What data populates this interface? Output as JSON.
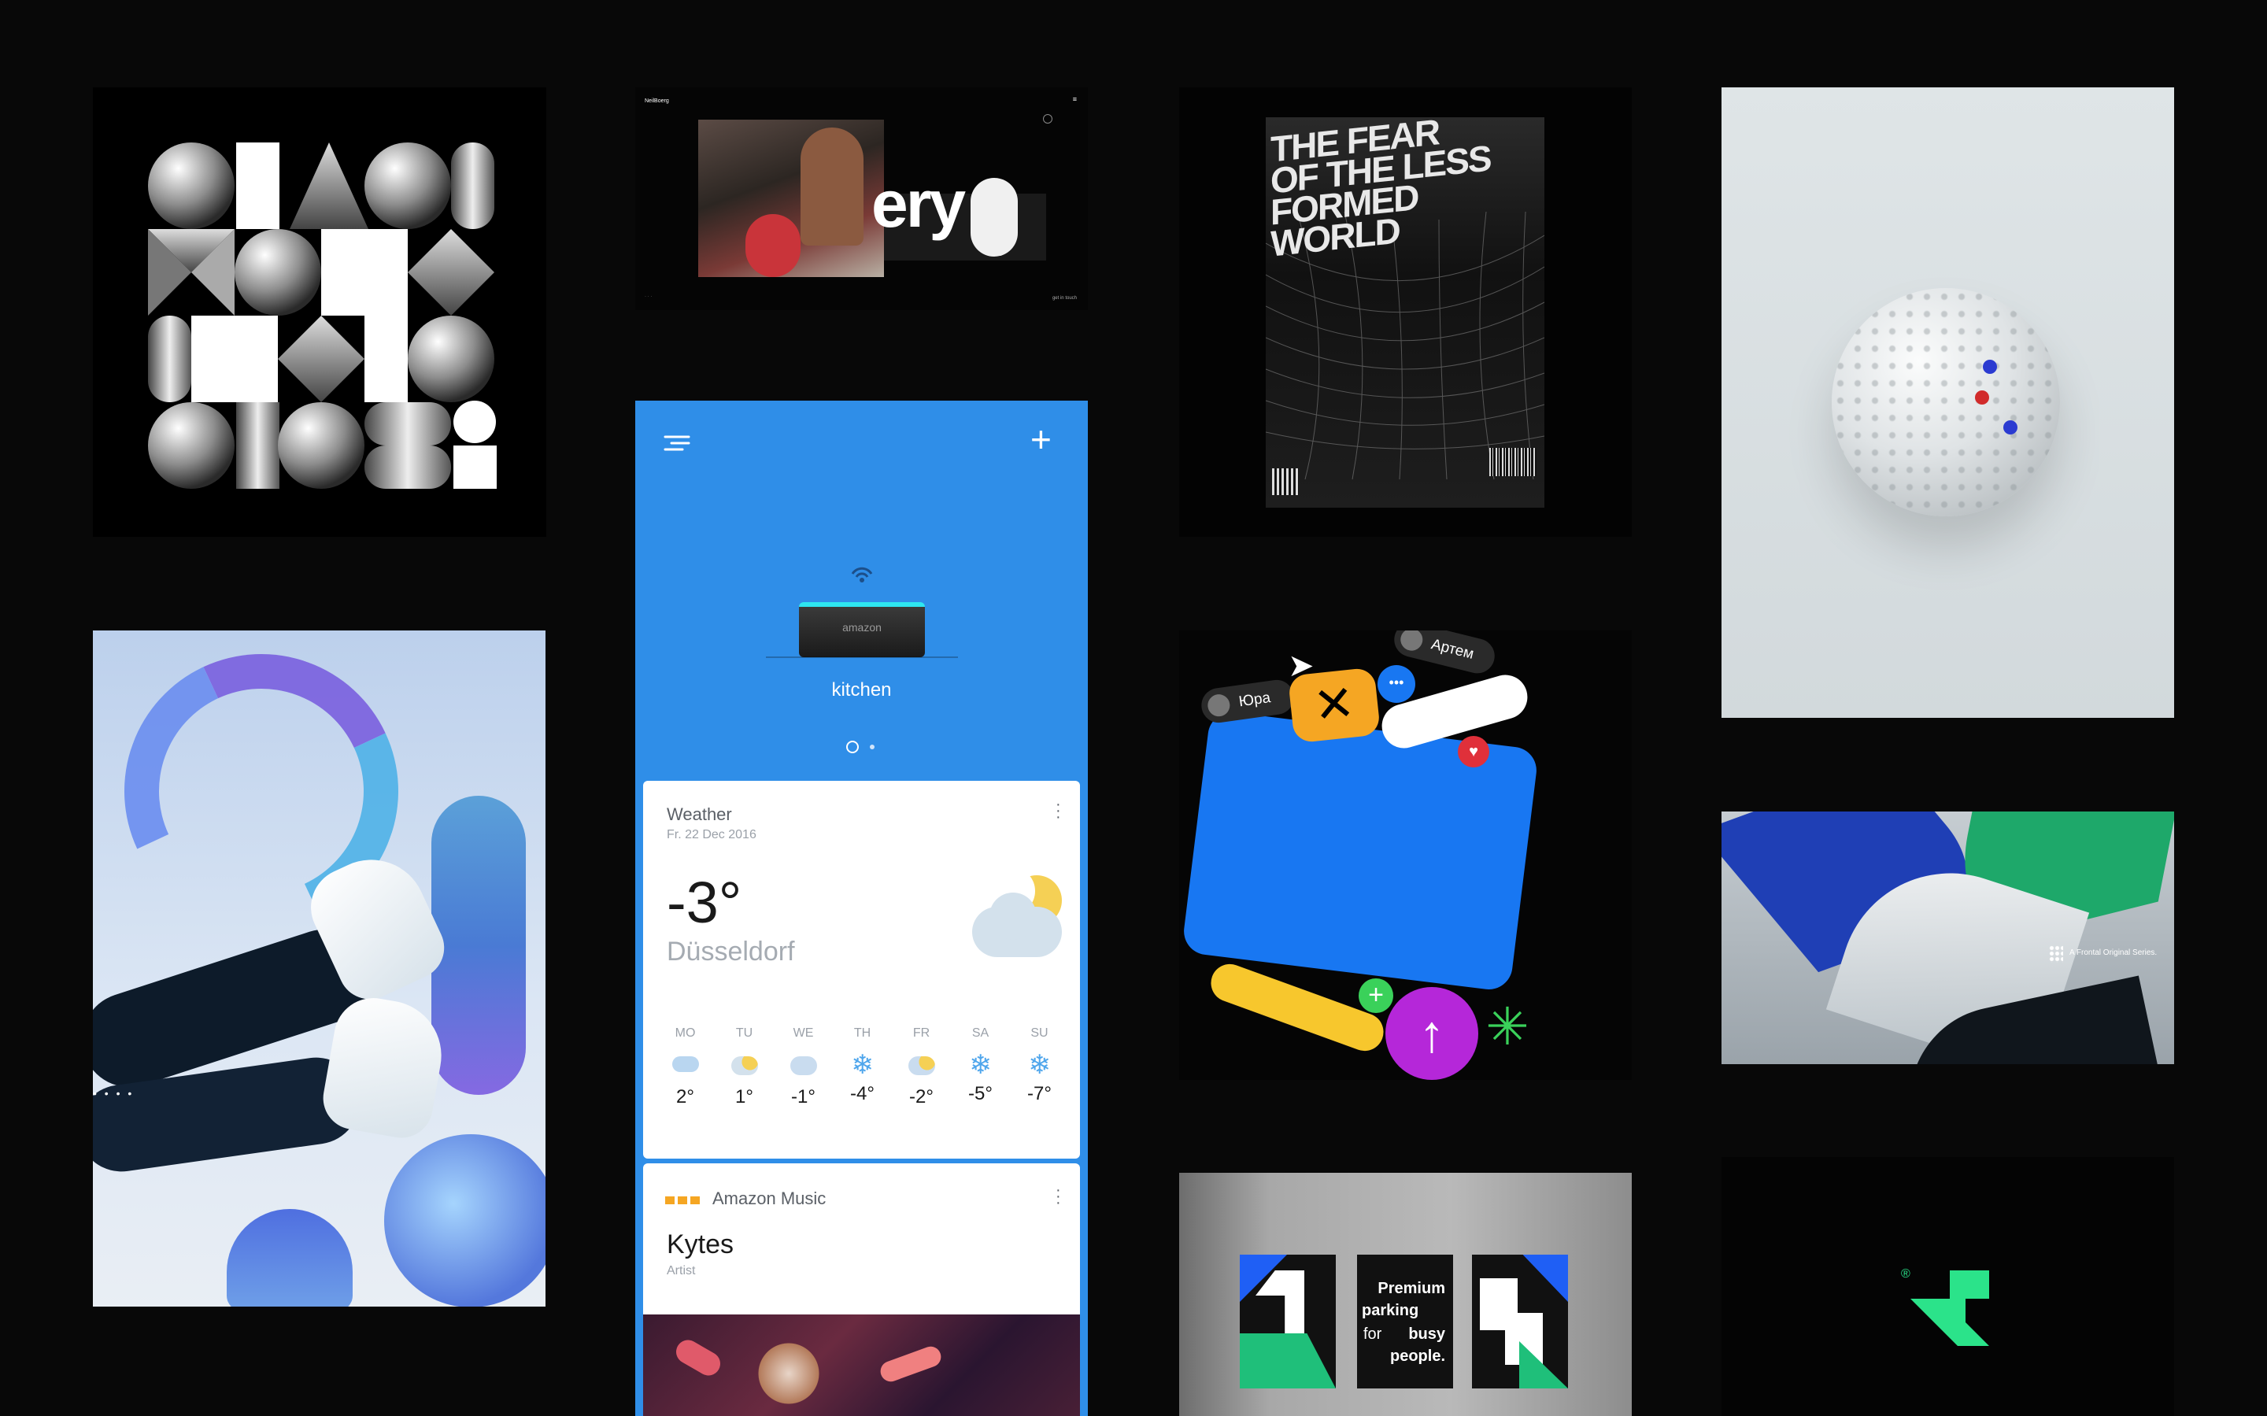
{
  "gallery": {
    "hero_slide": {
      "brand": "NeilBoerg",
      "menu": "≡",
      "word": "ery",
      "footer_right": "get in touch"
    },
    "poster": {
      "headline_lines": [
        "THE FEAR",
        "OF THE LESS",
        "FORMED",
        "WORLD"
      ]
    },
    "app": {
      "device_name": "kitchen",
      "device_brand": "amazon",
      "weather": {
        "title": "Weather",
        "date": "Fr. 22 Dec 2016",
        "temp": "-3°",
        "city": "Düsseldorf",
        "forecast": [
          {
            "day": "MO",
            "temp": "2°",
            "icon": "fog-icon"
          },
          {
            "day": "TU",
            "temp": "1°",
            "icon": "sun-cloud-icon"
          },
          {
            "day": "WE",
            "temp": "-1°",
            "icon": "snow-cloud-icon"
          },
          {
            "day": "TH",
            "temp": "-4°",
            "icon": "snowflake-icon"
          },
          {
            "day": "FR",
            "temp": "-2°",
            "icon": "sun-snow-icon"
          },
          {
            "day": "SA",
            "temp": "-5°",
            "icon": "snowflake-icon"
          },
          {
            "day": "SU",
            "temp": "-7°",
            "icon": "snowflake-icon"
          }
        ]
      },
      "music": {
        "source": "Amazon Music",
        "artist": "Kytes",
        "subtitle": "Artist"
      }
    },
    "chat": {
      "user1": "Юра",
      "user2": "Артем"
    },
    "abstract_banner": {
      "caption": "A Frontal Original Series."
    },
    "parking": {
      "line1": "Premium",
      "line2": "parking",
      "line3": "for",
      "line4": "busy",
      "line5": "people."
    },
    "logo": {
      "mark": "®"
    }
  },
  "colors": {
    "background": "#080808",
    "app_blue": "#2f8ee8",
    "chat_blue": "#1877f2",
    "chat_orange": "#f5a623",
    "chat_yellow": "#f7c72d",
    "chat_purple": "#b527d9",
    "chat_green": "#3ad15a",
    "brand_green": "#2be38a",
    "parking_blue": "#1f5ff5",
    "parking_green": "#1fbf7a"
  }
}
